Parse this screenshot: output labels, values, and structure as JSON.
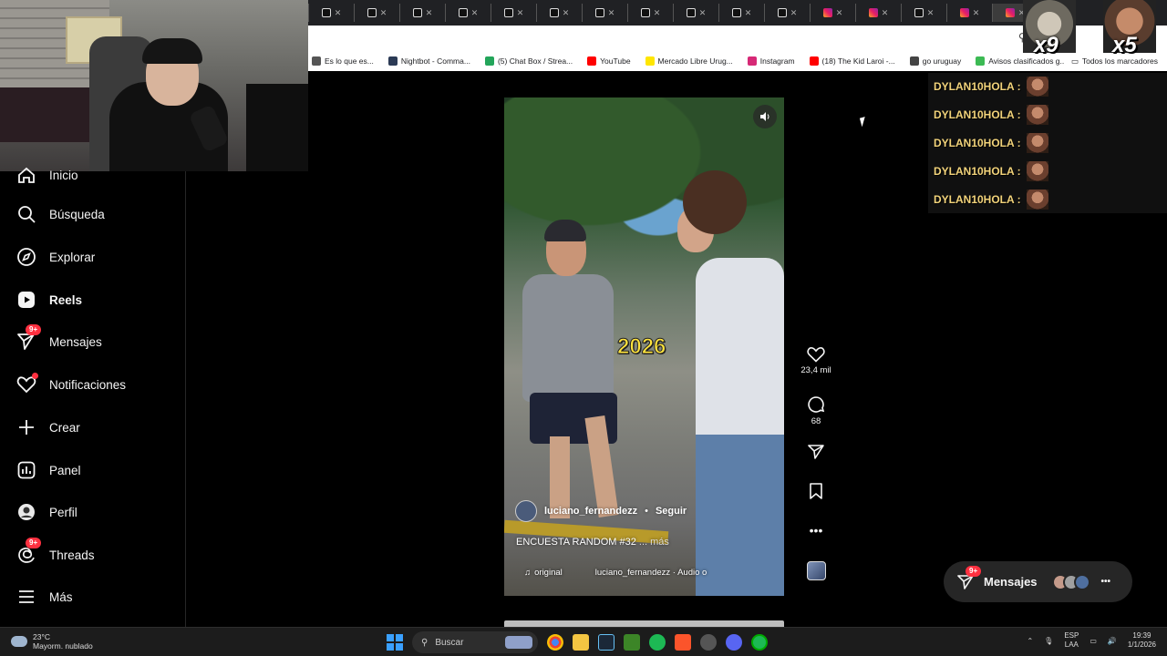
{
  "browser": {
    "bookmarks": [
      {
        "label": "Es lo que es...",
        "icon": "bookmark-favicon",
        "color": "#555555"
      },
      {
        "label": "Nightbot - Comma...",
        "icon": "nightbot-icon",
        "color": "#2b3a55"
      },
      {
        "label": "(5) Chat Box / Strea...",
        "icon": "chatbox-icon",
        "color": "#23a55a"
      },
      {
        "label": "YouTube",
        "icon": "youtube-icon",
        "color": "#ff0000"
      },
      {
        "label": "Mercado Libre Urug...",
        "icon": "mercadolibre-icon",
        "color": "#ffe600"
      },
      {
        "label": "Instagram",
        "icon": "instagram-icon",
        "color": "#d62976"
      },
      {
        "label": "(18) The Kid Laroi -...",
        "icon": "youtube-icon",
        "color": "#ff0000"
      },
      {
        "label": "go uruguay",
        "icon": "globe-icon",
        "color": "#444444"
      },
      {
        "label": "Avisos clasificados g...",
        "icon": "gallito-icon",
        "color": "#3cba54"
      }
    ],
    "all_bookmarks": "Todos los marcadores",
    "tab_count": 16
  },
  "emotes": {
    "count1": "x9",
    "count2": "x5"
  },
  "sidebar": {
    "items": [
      {
        "label": "Inicio",
        "icon": "home-icon"
      },
      {
        "label": "Búsqueda",
        "icon": "search-icon"
      },
      {
        "label": "Explorar",
        "icon": "compass-icon"
      },
      {
        "label": "Reels",
        "icon": "reels-icon"
      },
      {
        "label": "Mensajes",
        "icon": "messenger-icon",
        "badge": "9+"
      },
      {
        "label": "Notificaciones",
        "icon": "heart-icon"
      },
      {
        "label": "Crear",
        "icon": "plus-icon"
      },
      {
        "label": "Panel",
        "icon": "chart-icon"
      },
      {
        "label": "Perfil",
        "icon": "avatar-icon"
      },
      {
        "label": "Threads",
        "icon": "threads-icon",
        "badge": "9+"
      },
      {
        "label": "Más",
        "icon": "menu-icon"
      }
    ]
  },
  "reel": {
    "overlay_text": "2026",
    "username": "luciano_fernandezz",
    "separator": "•",
    "follow": "Seguir",
    "caption": "ENCUESTA RANDOM #32",
    "more": "... más",
    "audio_left": "original",
    "audio_right": "luciano_fernandezz · Audio o",
    "likes": "23,4 mil",
    "comments": "68"
  },
  "chat": {
    "messages": [
      {
        "user": "DYLAN10HOLA :"
      },
      {
        "user": "DYLAN10HOLA :"
      },
      {
        "user": "DYLAN10HOLA :"
      },
      {
        "user": "DYLAN10HOLA :"
      },
      {
        "user": "DYLAN10HOLA :"
      }
    ]
  },
  "messages_pill": {
    "label": "Mensajes",
    "badge": "9+"
  },
  "taskbar": {
    "temperature": "23°C",
    "weather": "Mayorm. nublado",
    "search_placeholder": "Buscar",
    "lang_top": "ESP",
    "lang_bottom": "LAA",
    "time": "19:39",
    "date": "1/1/2026"
  },
  "colors": {
    "accent_red": "#ff3040",
    "chat_name": "#f2d37a",
    "overlay_yellow": "#ffe43d"
  }
}
